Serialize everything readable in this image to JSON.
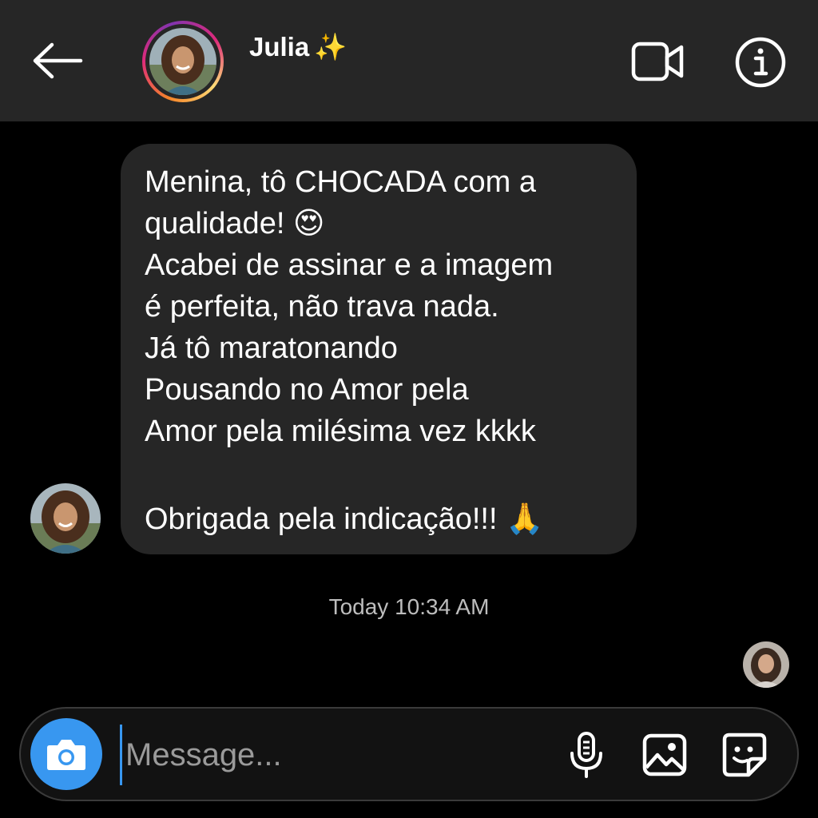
{
  "header": {
    "contact_name": "Julia",
    "name_emoji": "✨"
  },
  "message": {
    "lines": [
      "Menina, tô CHOCADA com a",
      "qualidade! 😍",
      "Acabei de assinar e a imagem",
      "é perfeita, não trava nada.",
      "Já tô maratonando",
      "Pousando no Amor pela",
      "Amor pela milésima vez kkkk"
    ],
    "closing_line": "Obrigada pela indicação!!! 🙏"
  },
  "timestamp": "Today 10:34 AM",
  "composer": {
    "placeholder": "Message..."
  },
  "icons": {
    "back": "arrow-left-icon",
    "video": "video-camera-icon",
    "info": "info-icon",
    "camera": "camera-icon",
    "mic": "microphone-icon",
    "gallery": "image-icon",
    "sticker": "sticker-icon"
  },
  "colors": {
    "header_bg": "#262626",
    "bubble_bg": "#262626",
    "accent": "#3897f0",
    "background": "#000000"
  }
}
